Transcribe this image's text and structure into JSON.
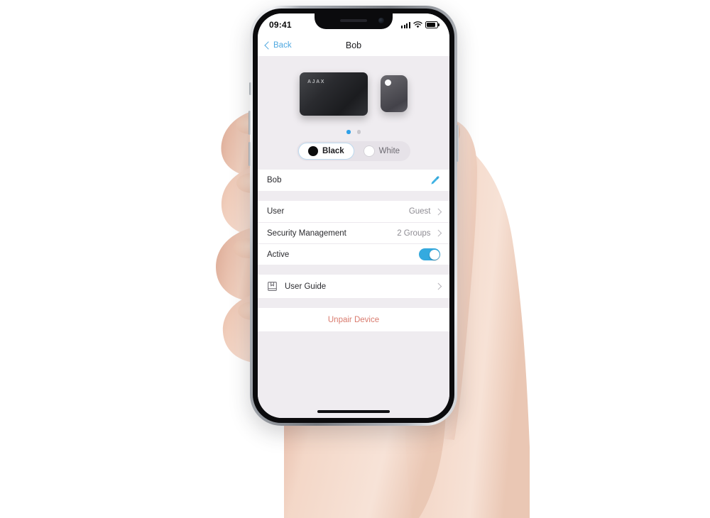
{
  "device_frame": {
    "type": "smartphone-in-hand",
    "notch": {
      "speaker_name": "earpiece-speaker",
      "camera_name": "front-camera"
    }
  },
  "statusbar": {
    "time": "09:41",
    "signal_icon": "cellular-signal-icon",
    "wifi_icon": "wifi-icon",
    "battery_icon": "battery-icon"
  },
  "navbar": {
    "back_label": "Back",
    "title": "Bob"
  },
  "hero": {
    "carousel": {
      "items": [
        {
          "name": "pass-card",
          "logo": "AJAX"
        },
        {
          "name": "tag-keyfob"
        }
      ],
      "dots": [
        {
          "active": true
        },
        {
          "active": false
        }
      ]
    },
    "color_segment": {
      "options": [
        {
          "label": "Black",
          "swatch": "#0c0c0d",
          "selected": true
        },
        {
          "label": "White",
          "swatch": "#ffffff",
          "selected": false
        }
      ]
    }
  },
  "name_row": {
    "value": "Bob",
    "edit_icon": "pencil-icon"
  },
  "settings": {
    "rows": [
      {
        "label": "User",
        "value": "Guest",
        "accessory": "chevron-right-icon"
      },
      {
        "label": "Security Management",
        "value": "2 Groups",
        "accessory": "chevron-right-icon"
      },
      {
        "label": "Active",
        "value": "",
        "accessory": "toggle-on"
      }
    ]
  },
  "guide": {
    "label": "User Guide",
    "icon": "book-icon",
    "accessory": "chevron-right-icon"
  },
  "danger": {
    "label": "Unpair Device"
  },
  "colors": {
    "accent_blue": "#34aadf",
    "link_blue": "#4fa8e0",
    "danger_red": "#d97b6e",
    "screen_bg": "#efecf0",
    "row_bg": "#ffffff"
  },
  "home_indicator": "home-indicator"
}
